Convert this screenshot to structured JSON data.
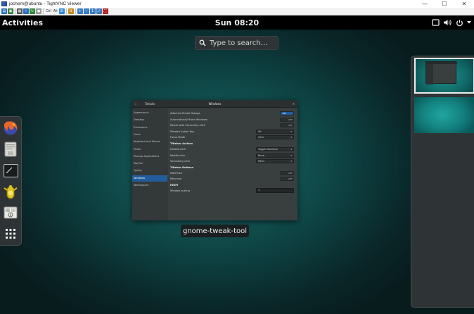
{
  "vnc": {
    "window_title": "jochem@ubuntu - TightVNC Viewer",
    "controls": {
      "minimize": "—",
      "maximize": "☐",
      "close": "✕"
    },
    "toolbar": [
      {
        "name": "new-connection-icon",
        "color": "#2a6ebb",
        "glyph": "▤"
      },
      {
        "name": "save-icon",
        "color": "#3b7a3b",
        "glyph": "▣"
      },
      {
        "name": "options-icon",
        "color": "#555555",
        "glyph": "▦"
      },
      {
        "name": "info-icon",
        "color": "#2f6fba",
        "glyph": "i"
      },
      {
        "name": "refresh-icon",
        "color": "#2c8a3a",
        "glyph": "↻"
      },
      {
        "name": "pause-icon",
        "color": "#999999",
        "glyph": "●"
      },
      {
        "name": "ctrl-key-icon",
        "text": "Ctrl"
      },
      {
        "name": "alt-key-icon",
        "text": "Alt"
      },
      {
        "name": "windows-key-icon",
        "color": "#2d89d8",
        "glyph": "⊞"
      },
      {
        "name": "transfer-icon",
        "color": "#c28b1f",
        "glyph": "⇅"
      },
      {
        "name": "zoom-in-icon",
        "color": "#3a7cc2",
        "glyph": "+"
      },
      {
        "name": "zoom-out-icon",
        "color": "#3a7cc2",
        "glyph": "−"
      },
      {
        "name": "zoom-100-icon",
        "color": "#3a7cc2",
        "glyph": "1"
      },
      {
        "name": "zoom-fit-icon",
        "color": "#3a7cc2",
        "glyph": "⤢"
      },
      {
        "name": "fullscreen-icon",
        "color": "#b22222",
        "glyph": "⛶"
      }
    ]
  },
  "gnome": {
    "activities": "Activities",
    "clock": "Sun 08:20",
    "search_placeholder": "Type to search…"
  },
  "window_caption": "gnome-tweak-tool",
  "tweak": {
    "app_name": "Tweaks",
    "section_title": "Windows",
    "search_icon": "🔍",
    "close": "✕",
    "sidebar": [
      "Appearance",
      "Desktop",
      "Extensions",
      "Fonts",
      "Keyboard and Mouse",
      "Power",
      "Startup Applications",
      "Top Bar",
      "Typing",
      "Windows",
      "Workspaces"
    ],
    "active_index": 9,
    "rows": [
      {
        "label": "Attached Modal Dialogs",
        "control": "toggle",
        "state": "ON"
      },
      {
        "label": "Automatically Raise Windows",
        "control": "toggle",
        "state": "OFF"
      },
      {
        "label": "Resize with Secondary-click",
        "control": "toggle",
        "state": "OFF"
      },
      {
        "label": "Window Action Key",
        "control": "combo",
        "value": "Alt"
      },
      {
        "label": "Focus Mode",
        "control": "combo",
        "value": "Click"
      },
      {
        "label": "Titlebar Actions",
        "control": "section"
      },
      {
        "label": "Double-click",
        "control": "combo",
        "value": "Toggle Maximize"
      },
      {
        "label": "Middle-click",
        "control": "combo",
        "value": "None"
      },
      {
        "label": "Secondary-click",
        "control": "combo",
        "value": "Menu"
      },
      {
        "label": "Titlebar Buttons",
        "control": "section"
      },
      {
        "label": "Maximize",
        "control": "toggle",
        "state": "OFF"
      },
      {
        "label": "Minimize",
        "control": "toggle",
        "state": "OFF"
      },
      {
        "label": "HiDPI",
        "control": "section"
      },
      {
        "label": "Window scaling",
        "control": "spin",
        "value": "1"
      }
    ]
  },
  "dash": [
    {
      "name": "firefox-icon"
    },
    {
      "name": "files-icon"
    },
    {
      "name": "terminal-icon"
    },
    {
      "name": "tweak-tool-icon"
    },
    {
      "name": "software-icon"
    },
    {
      "name": "show-apps-icon"
    }
  ],
  "colors": {
    "accent": "#215d9c",
    "panel": "#000000",
    "overview_bg": "#135856"
  }
}
